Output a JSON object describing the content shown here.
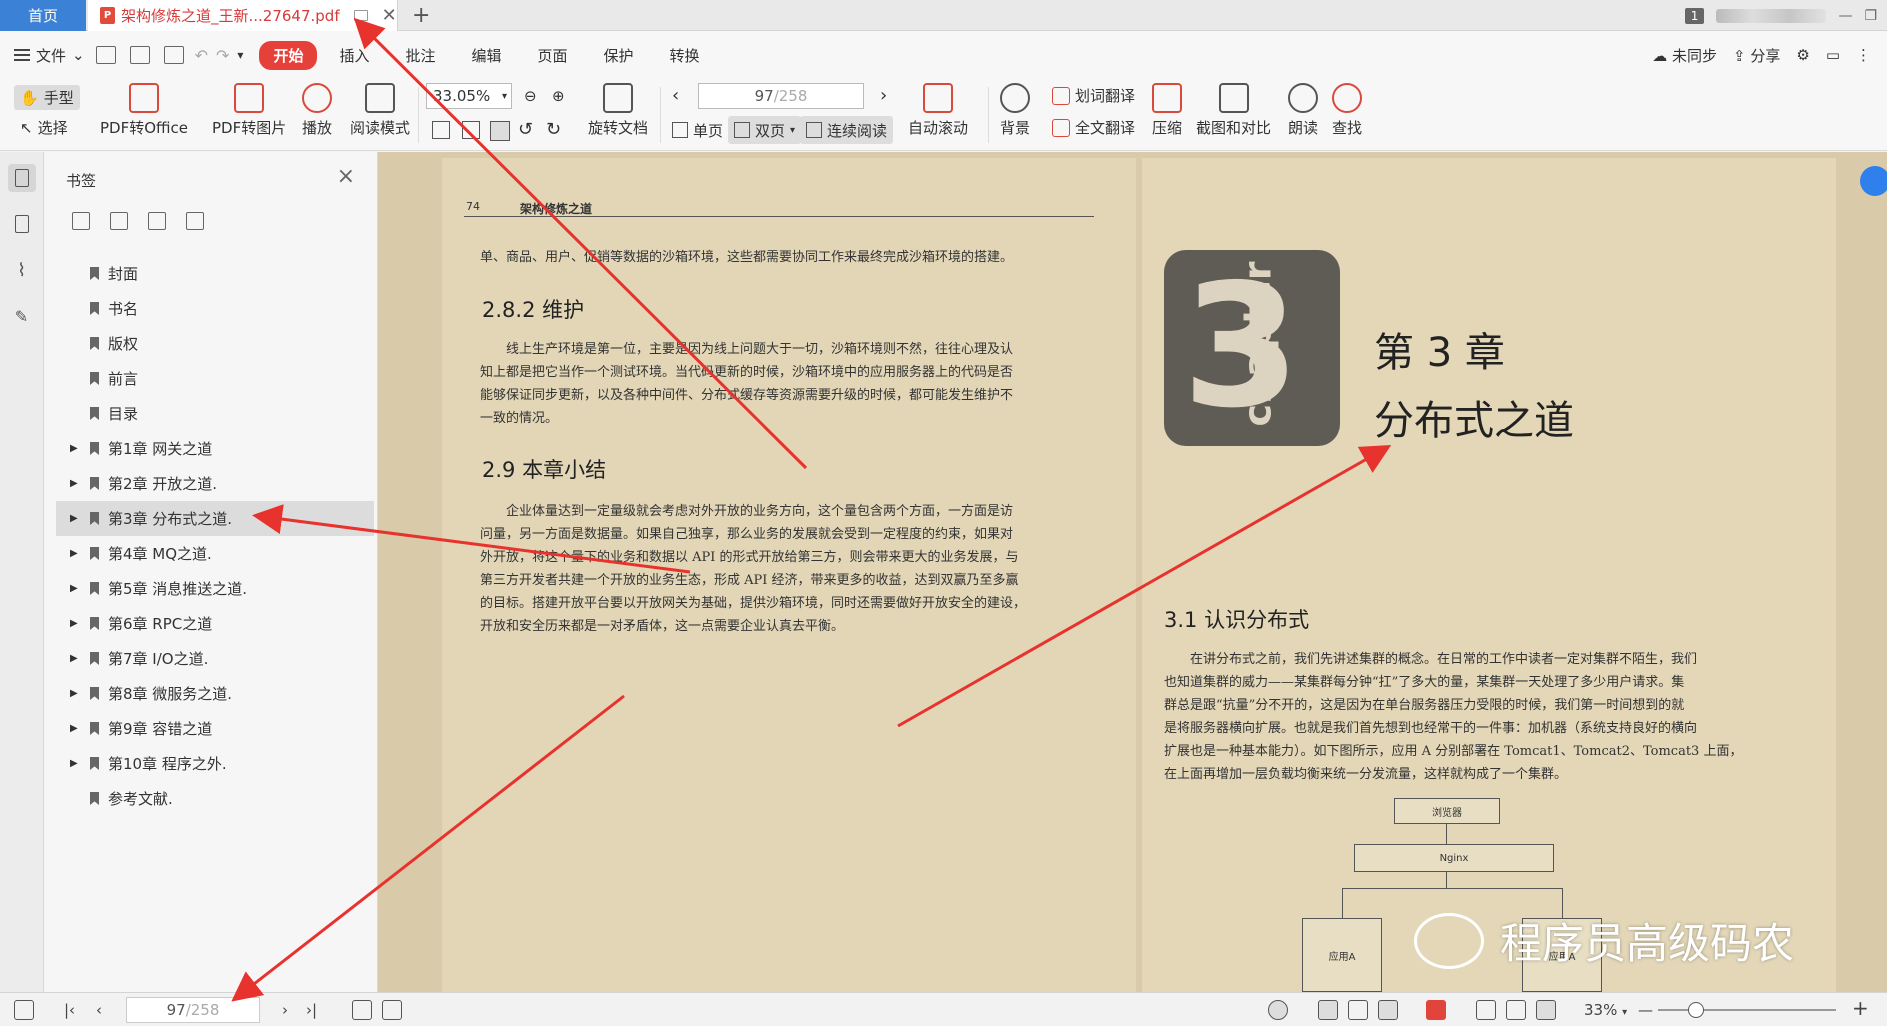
{
  "tabs": {
    "home_label": "首页",
    "doc_title": "架构修炼之道_王新...27647.pdf",
    "pdf_badge": "P",
    "plus": "+",
    "close": "✕",
    "count": "1"
  },
  "window_controls": [
    "—",
    "❐"
  ],
  "menubar": {
    "file_label": "文件",
    "tabs": [
      "开始",
      "插入",
      "批注",
      "编辑",
      "页面",
      "保护",
      "转换"
    ],
    "active_tab": "开始",
    "right": [
      "未同步",
      "分享"
    ]
  },
  "toolbar": {
    "hand_label": "手型",
    "select_label": "选择",
    "big_tools": [
      "PDF转Office",
      "PDF转图片",
      "播放",
      "阅读模式"
    ],
    "zoom_value": "33.05%",
    "rotate_label": "旋转文档",
    "page_current": "97",
    "page_total": "/258",
    "layout": [
      "单页",
      "双页",
      "连续阅读"
    ],
    "auto_scroll": "自动滚动",
    "background": "背景",
    "word_translate": "划词翻译",
    "full_translate": "全文翻译",
    "compress": "压缩",
    "screenshot_compare": "截图和对比",
    "read_aloud": "朗读",
    "find": "查找"
  },
  "bookmark_panel": {
    "title": "书签",
    "items": [
      {
        "label": "封面",
        "expandable": false
      },
      {
        "label": "书名",
        "expandable": false
      },
      {
        "label": "版权",
        "expandable": false
      },
      {
        "label": "前言",
        "expandable": false
      },
      {
        "label": "目录",
        "expandable": false
      },
      {
        "label": "第1章 网关之道",
        "expandable": true
      },
      {
        "label": "第2章 开放之道.",
        "expandable": true
      },
      {
        "label": "第3章 分布式之道.",
        "expandable": true,
        "selected": true
      },
      {
        "label": "第4章 MQ之道.",
        "expandable": true
      },
      {
        "label": "第5章 消息推送之道.",
        "expandable": true
      },
      {
        "label": "第6章 RPC之道",
        "expandable": true
      },
      {
        "label": "第7章 I/O之道.",
        "expandable": true
      },
      {
        "label": "第8章 微服务之道.",
        "expandable": true
      },
      {
        "label": "第9章 容错之道",
        "expandable": true
      },
      {
        "label": "第10章 程序之外.",
        "expandable": true
      },
      {
        "label": "参考文献.",
        "expandable": false
      }
    ]
  },
  "left_page": {
    "page_number": "74",
    "header_title": "架构修炼之道",
    "line1": "单、商品、用户、促销等数据的沙箱环境，这些都需要协同工作来最终完成沙箱环境的搭建。",
    "h_282": "2.8.2   维护",
    "para_282": [
      "线上生产环境是第一位，主要是因为线上问题大于一切，沙箱环境则不然，往往心理及认",
      "知上都是把它当作一个测试环境。当代码更新的时候，沙箱环境中的应用服务器上的代码是否",
      "能够保证同步更新，以及各种中间件、分布式缓存等资源需要升级的时候，都可能发生维护不",
      "一致的情况。"
    ],
    "h_29": "2.9   本章小结",
    "para_29": [
      "企业体量达到一定量级就会考虑对外开放的业务方向，这个量包含两个方面，一方面是访",
      "问量，另一方面是数据量。如果自己独享，那么业务的发展就会受到一定程度的约束，如果对",
      "外开放，将这个量下的业务和数据以 API 的形式开放给第三方，则会带来更大的业务发展，与",
      "第三方开发者共建一个开放的业务生态，形成 API 经济，带来更多的收益，达到双赢乃至多赢",
      "的目标。搭建开放平台要以开放网关为基础，提供沙箱环境，同时还需要做好开放安全的建设，",
      "开放和安全历来都是一对矛盾体，这一点需要企业认真去平衡。"
    ]
  },
  "right_page": {
    "chapter_number": "3",
    "chapter_word": "chapter",
    "chapter_title1": "第 3 章",
    "chapter_title2": "分布式之道",
    "h_31": "3.1   认识分布式",
    "para_31": [
      "在讲分布式之前，我们先讲述集群的概念。在日常的工作中读者一定对集群不陌生，我们",
      "也知道集群的威力——某集群每分钟“扛”了多大的量，某集群一天处理了多少用户请求。集",
      "群总是跟“抗量”分不开的，这是因为在单台服务器压力受限的时候，我们第一时间想到的就",
      "是将服务器横向扩展。也就是我们首先想到也经常干的一件事：加机器（系统支持良好的横向",
      "扩展也是一种基本能力）。如下图所示，应用 A 分别部署在 Tomcat1、Tomcat2、Tomcat3 上面，",
      "在上面再增加一层负载均衡来统一分发流量，这样就构成了一个集群。"
    ],
    "diagram": {
      "browser": "浏览器",
      "nginx": "Nginx",
      "app_a1": "应用A",
      "app_a2": "应用A"
    }
  },
  "watermark": "程序员高级码农",
  "statusbar": {
    "page_current": "97",
    "page_total": "/258",
    "zoom": "33%",
    "minus": "—",
    "plus": "+"
  },
  "colors": {
    "accent_red": "#e5413a",
    "annotation_arrow": "#e8322d",
    "home_tab_blue": "#3b82d6",
    "page_paper": "#e2d6b7"
  }
}
